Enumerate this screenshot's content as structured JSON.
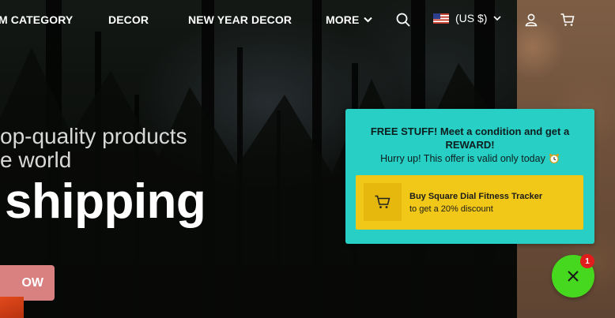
{
  "nav": {
    "items": [
      {
        "label": "M CATEGORY"
      },
      {
        "label": "DECOR"
      },
      {
        "label": "NEW YEAR DECOR"
      },
      {
        "label": "MORE"
      }
    ],
    "currency": "(US $)",
    "icons": [
      "search-icon",
      "user-icon",
      "cart-icon",
      "chevron-down-icon"
    ]
  },
  "hero": {
    "line1": "op-quality products",
    "line2": "e world",
    "line3": "shipping",
    "cta_label": "OW"
  },
  "popup": {
    "title": "FREE STUFF! Meet a condition and get a REWARD!",
    "subtitle": "Hurry up! This offer is valid only today",
    "offer_title": "Buy Square Dial Fitness Tracker",
    "offer_subtitle": "to get a 20% discount",
    "colors": {
      "background": "#27cfc4",
      "offer": "#f1c818"
    }
  },
  "fab": {
    "badge_count": "1",
    "color": "#46d81e",
    "badge_color": "#e01c1c"
  }
}
